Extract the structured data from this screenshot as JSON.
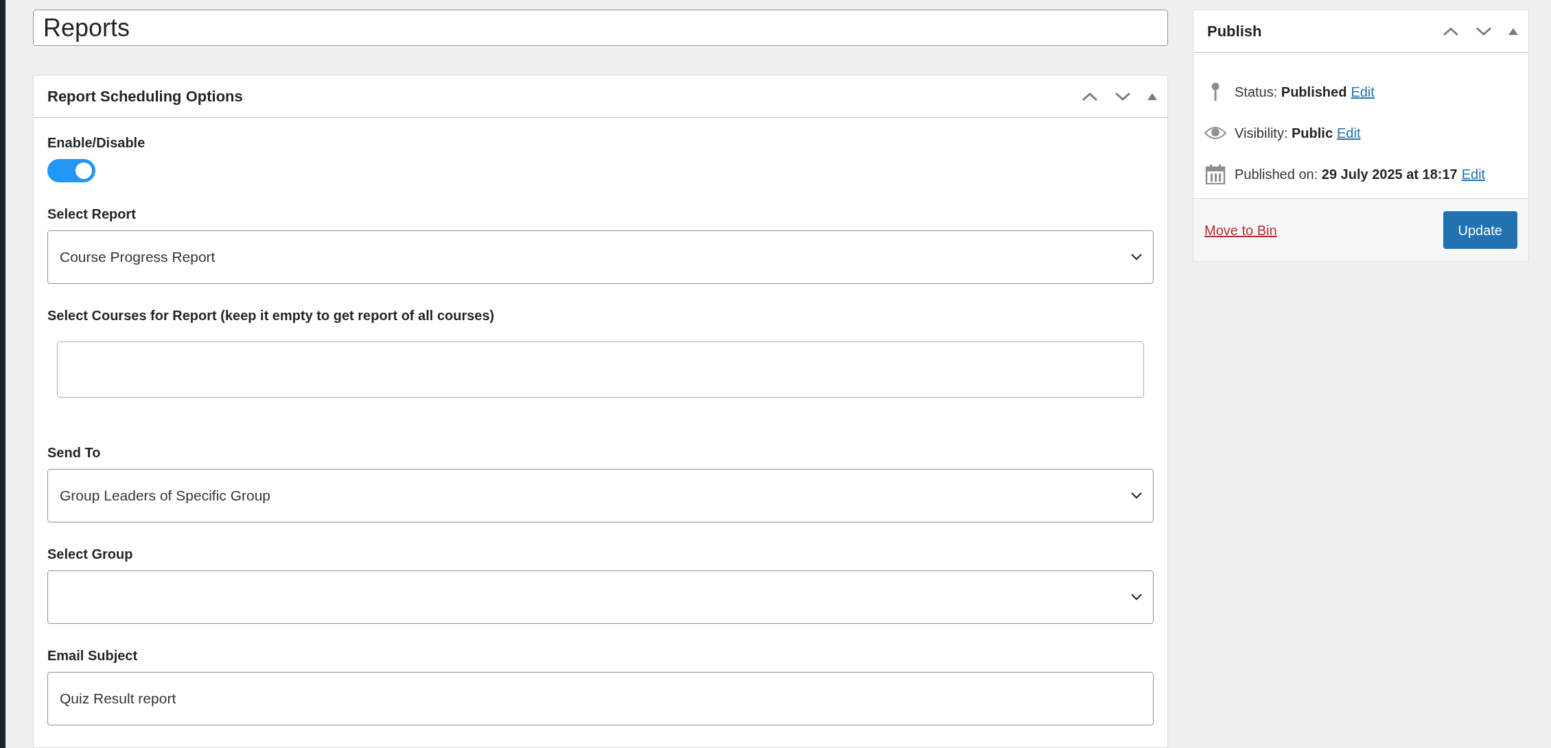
{
  "title_field": {
    "value": "Reports"
  },
  "panel": {
    "title": "Report Scheduling Options",
    "fields": [
      {
        "kind": "toggle",
        "label": "Enable/Disable",
        "on": true
      },
      {
        "kind": "select",
        "label": "Select Report",
        "value": "Course Progress Report"
      },
      {
        "kind": "multiselect",
        "label": "Select Courses for Report (keep it empty to get report of all courses)"
      },
      {
        "kind": "select",
        "label": "Send To",
        "value": "Group Leaders of Specific Group"
      },
      {
        "kind": "select",
        "label": "Select Group"
      },
      {
        "kind": "text",
        "label": "Email Subject",
        "value": "Quiz Result report"
      }
    ]
  },
  "publish": {
    "title": "Publish",
    "rows": [
      {
        "kind": "status",
        "label": "Status:",
        "value": "Published",
        "link": "Edit"
      },
      {
        "kind": "visibility",
        "label": "Visibility:",
        "value": "Public",
        "link": "Edit"
      },
      {
        "kind": "date",
        "label": "Published on:",
        "value": "29 July 2025 at 18:17",
        "link": "Edit"
      }
    ],
    "trash_link": "Move to Bin",
    "update_button": "Update"
  }
}
